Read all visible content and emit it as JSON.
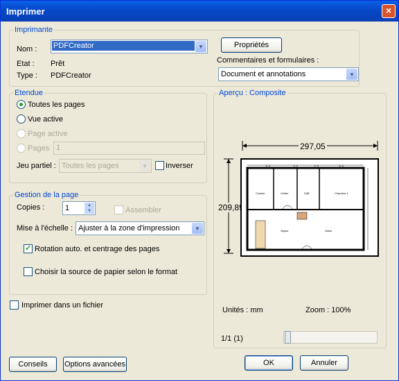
{
  "window": {
    "title": "Imprimer",
    "close_glyph": "×"
  },
  "printer": {
    "legend": "Imprimante",
    "name_label": "Nom :",
    "name_value": "PDFCreator",
    "status_label": "Etat :",
    "status_value": "Prêt",
    "type_label": "Type :",
    "type_value": "PDFCreator",
    "properties_button": "Propriétés",
    "comments_label": "Commentaires et formulaires :",
    "comments_value": "Document et annotations"
  },
  "range": {
    "legend": "Etendue",
    "all_pages": "Toutes les pages",
    "current_view": "Vue active",
    "current_page": "Page active",
    "pages": "Pages",
    "pages_value": "1",
    "subset_label": "Jeu partiel :",
    "subset_value": "Toutes les pages",
    "reverse": "Inverser"
  },
  "handling": {
    "legend": "Gestion de la page",
    "copies_label": "Copies :",
    "copies_value": "1",
    "collate": "Assembler",
    "scaling_label": "Mise à l'échelle :",
    "scaling_value": "Ajuster à la zone d'impression",
    "auto_rotate": "Rotation auto. et centrage des pages",
    "paper_source": "Choisir la source de papier selon le format"
  },
  "print_to_file": "Imprimer dans un fichier",
  "preview": {
    "legend": "Aperçu : Composite",
    "width": "297,05",
    "height": "209,89",
    "units": "Unités : mm",
    "zoom": "Zoom : 100%",
    "page_counter": "1/1 (1)",
    "slider_position": 0,
    "plan_labels": {
      "dims": [
        "3.3",
        "2.2",
        "2.2",
        "3.3"
      ],
      "rooms": [
        "Cuisine",
        "Cellier",
        "SdB",
        "Chambre 1",
        "Séjour",
        "Salon"
      ]
    }
  },
  "footer": {
    "tips": "Conseils",
    "advanced": "Options avancées",
    "ok": "OK",
    "cancel": "Annuler"
  }
}
